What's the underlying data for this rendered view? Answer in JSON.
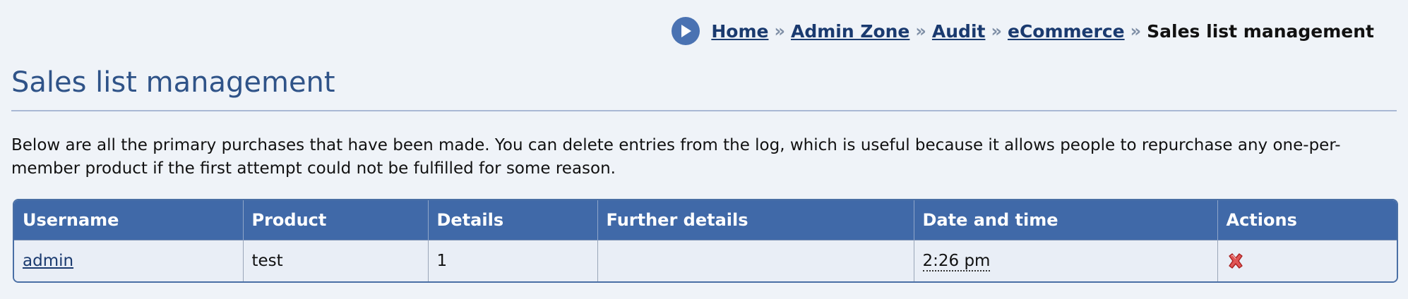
{
  "breadcrumb": {
    "items": [
      "Home",
      "Admin Zone",
      "Audit",
      "eCommerce"
    ],
    "separator": "»",
    "current": "Sales list management"
  },
  "page": {
    "title": "Sales list management",
    "intro": "Below are all the primary purchases that have been made. You can delete entries from the log, which is useful because it allows people to repurchase any one-per-member product if the first attempt could not be fulfilled for some reason."
  },
  "table": {
    "headers": [
      "Username",
      "Product",
      "Details",
      "Further details",
      "Date and time",
      "Actions"
    ],
    "rows": [
      {
        "username": "admin",
        "product": "test",
        "details": "1",
        "further_details": "",
        "date_time": "2:26 pm",
        "action_icon": "delete-icon"
      }
    ]
  },
  "colors": {
    "accent": "#4069a8",
    "link": "#1a3a6f",
    "title": "#2f5388",
    "background": "#eff3f8"
  }
}
